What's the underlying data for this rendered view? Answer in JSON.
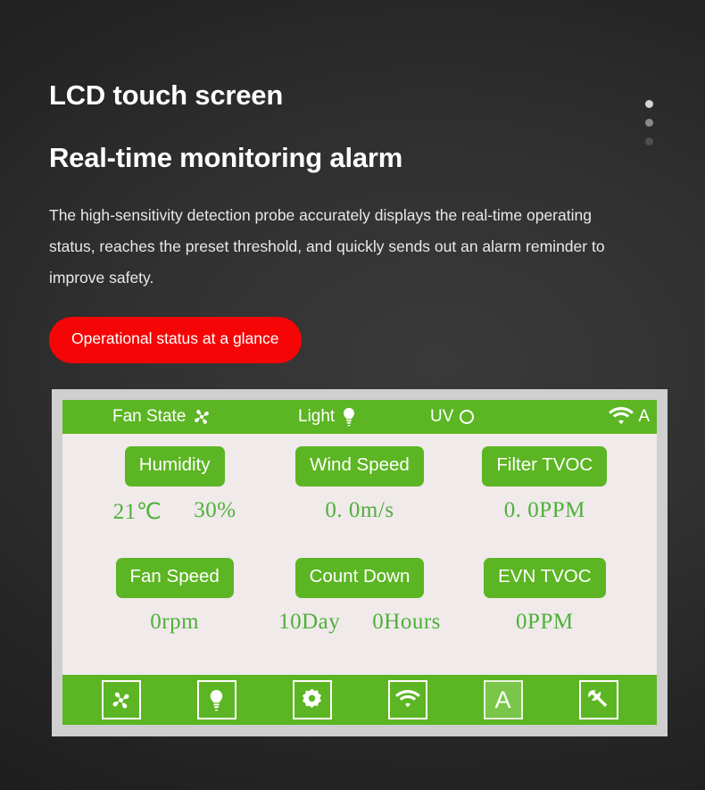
{
  "hero": {
    "headline_1": "LCD touch screen",
    "headline_2": "Real-time monitoring alarm",
    "paragraph": "The high-sensitivity detection probe accurately displays the real-time operating status, reaches the preset threshold, and quickly sends out an alarm reminder to improve safety.",
    "cta_label": "Operational status at a glance"
  },
  "carousel": {
    "dots": [
      "dot-active",
      "dot-inactive",
      "dot-inactive"
    ]
  },
  "device": {
    "status_bar": {
      "fan_label": "Fan State",
      "fan_icon": "fan-icon",
      "light_label": "Light",
      "light_icon": "light-bulb-icon",
      "uv_label": "UV",
      "uv_icon": "circle-outline-icon",
      "wifi_icon": "wifi-icon",
      "mode_label": "A"
    },
    "readings": [
      {
        "label": "Humidity",
        "value": "21℃",
        "value_2": "30%"
      },
      {
        "label": "Wind Speed",
        "value": "0. 0m/s",
        "value_2": ""
      },
      {
        "label": "Filter TVOC",
        "value": "0. 0PPM",
        "value_2": ""
      },
      {
        "label": "Fan Speed",
        "value": "0rpm",
        "value_2": ""
      },
      {
        "label": "Count Down",
        "value": "10Day",
        "value_2": "0Hours"
      },
      {
        "label": "EVN TVOC",
        "value": "0PPM",
        "value_2": ""
      }
    ],
    "toolbar": [
      {
        "icon": "fan-icon",
        "label": "",
        "active": false
      },
      {
        "icon": "light-bulb-icon",
        "label": "",
        "active": false
      },
      {
        "icon": "uv-lamp-icon",
        "label": "",
        "active": false
      },
      {
        "icon": "wifi-icon",
        "label": "",
        "active": false
      },
      {
        "icon": "auto-mode-icon",
        "label": "A",
        "active": true
      },
      {
        "icon": "tools-icon",
        "label": "",
        "active": false
      }
    ]
  },
  "colors": {
    "accent_green": "#5cb523",
    "value_green": "#4fb03b",
    "cta_red": "#f50505",
    "bezel_gray": "#cfcfcf",
    "screen_bg": "#f0eaea"
  }
}
